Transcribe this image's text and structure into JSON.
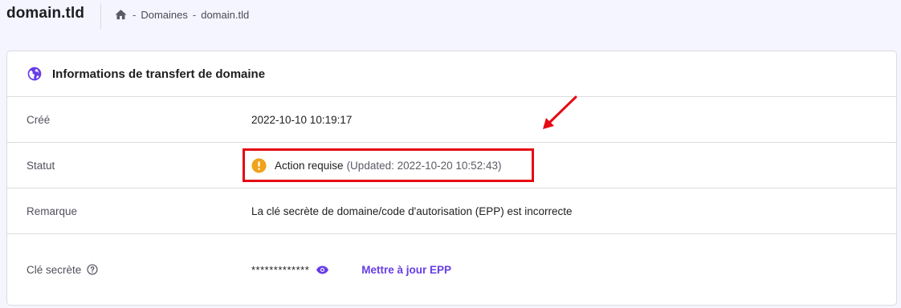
{
  "header": {
    "site_title": "domain.tld",
    "breadcrumb": {
      "sep1": "-",
      "item1": "Domaines",
      "sep2": "-",
      "item2": "domain.tld"
    }
  },
  "card": {
    "title": "Informations de transfert de domaine",
    "rows": [
      {
        "label": "Créé",
        "value": "2022-10-10 10:19:17"
      },
      {
        "label": "Statut",
        "status_text": "Action requise",
        "status_updated": "(Updated: 2022-10-20 10:52:43)"
      },
      {
        "label": "Remarque",
        "value": "La clé secrète de domaine/code d'autorisation (EPP) est incorrecte"
      },
      {
        "label": "Clé secrète",
        "masked_value": "*************",
        "link": "Mettre à jour EPP"
      }
    ]
  },
  "colors": {
    "accent": "#673de6",
    "warning": "#f0a21a",
    "annotation": "#e50914",
    "background": "#f4f5ff"
  },
  "icons": {
    "home": "home-icon",
    "globe": "globe-icon",
    "warning": "warning-icon",
    "help": "help-icon",
    "eye": "eye-icon"
  }
}
